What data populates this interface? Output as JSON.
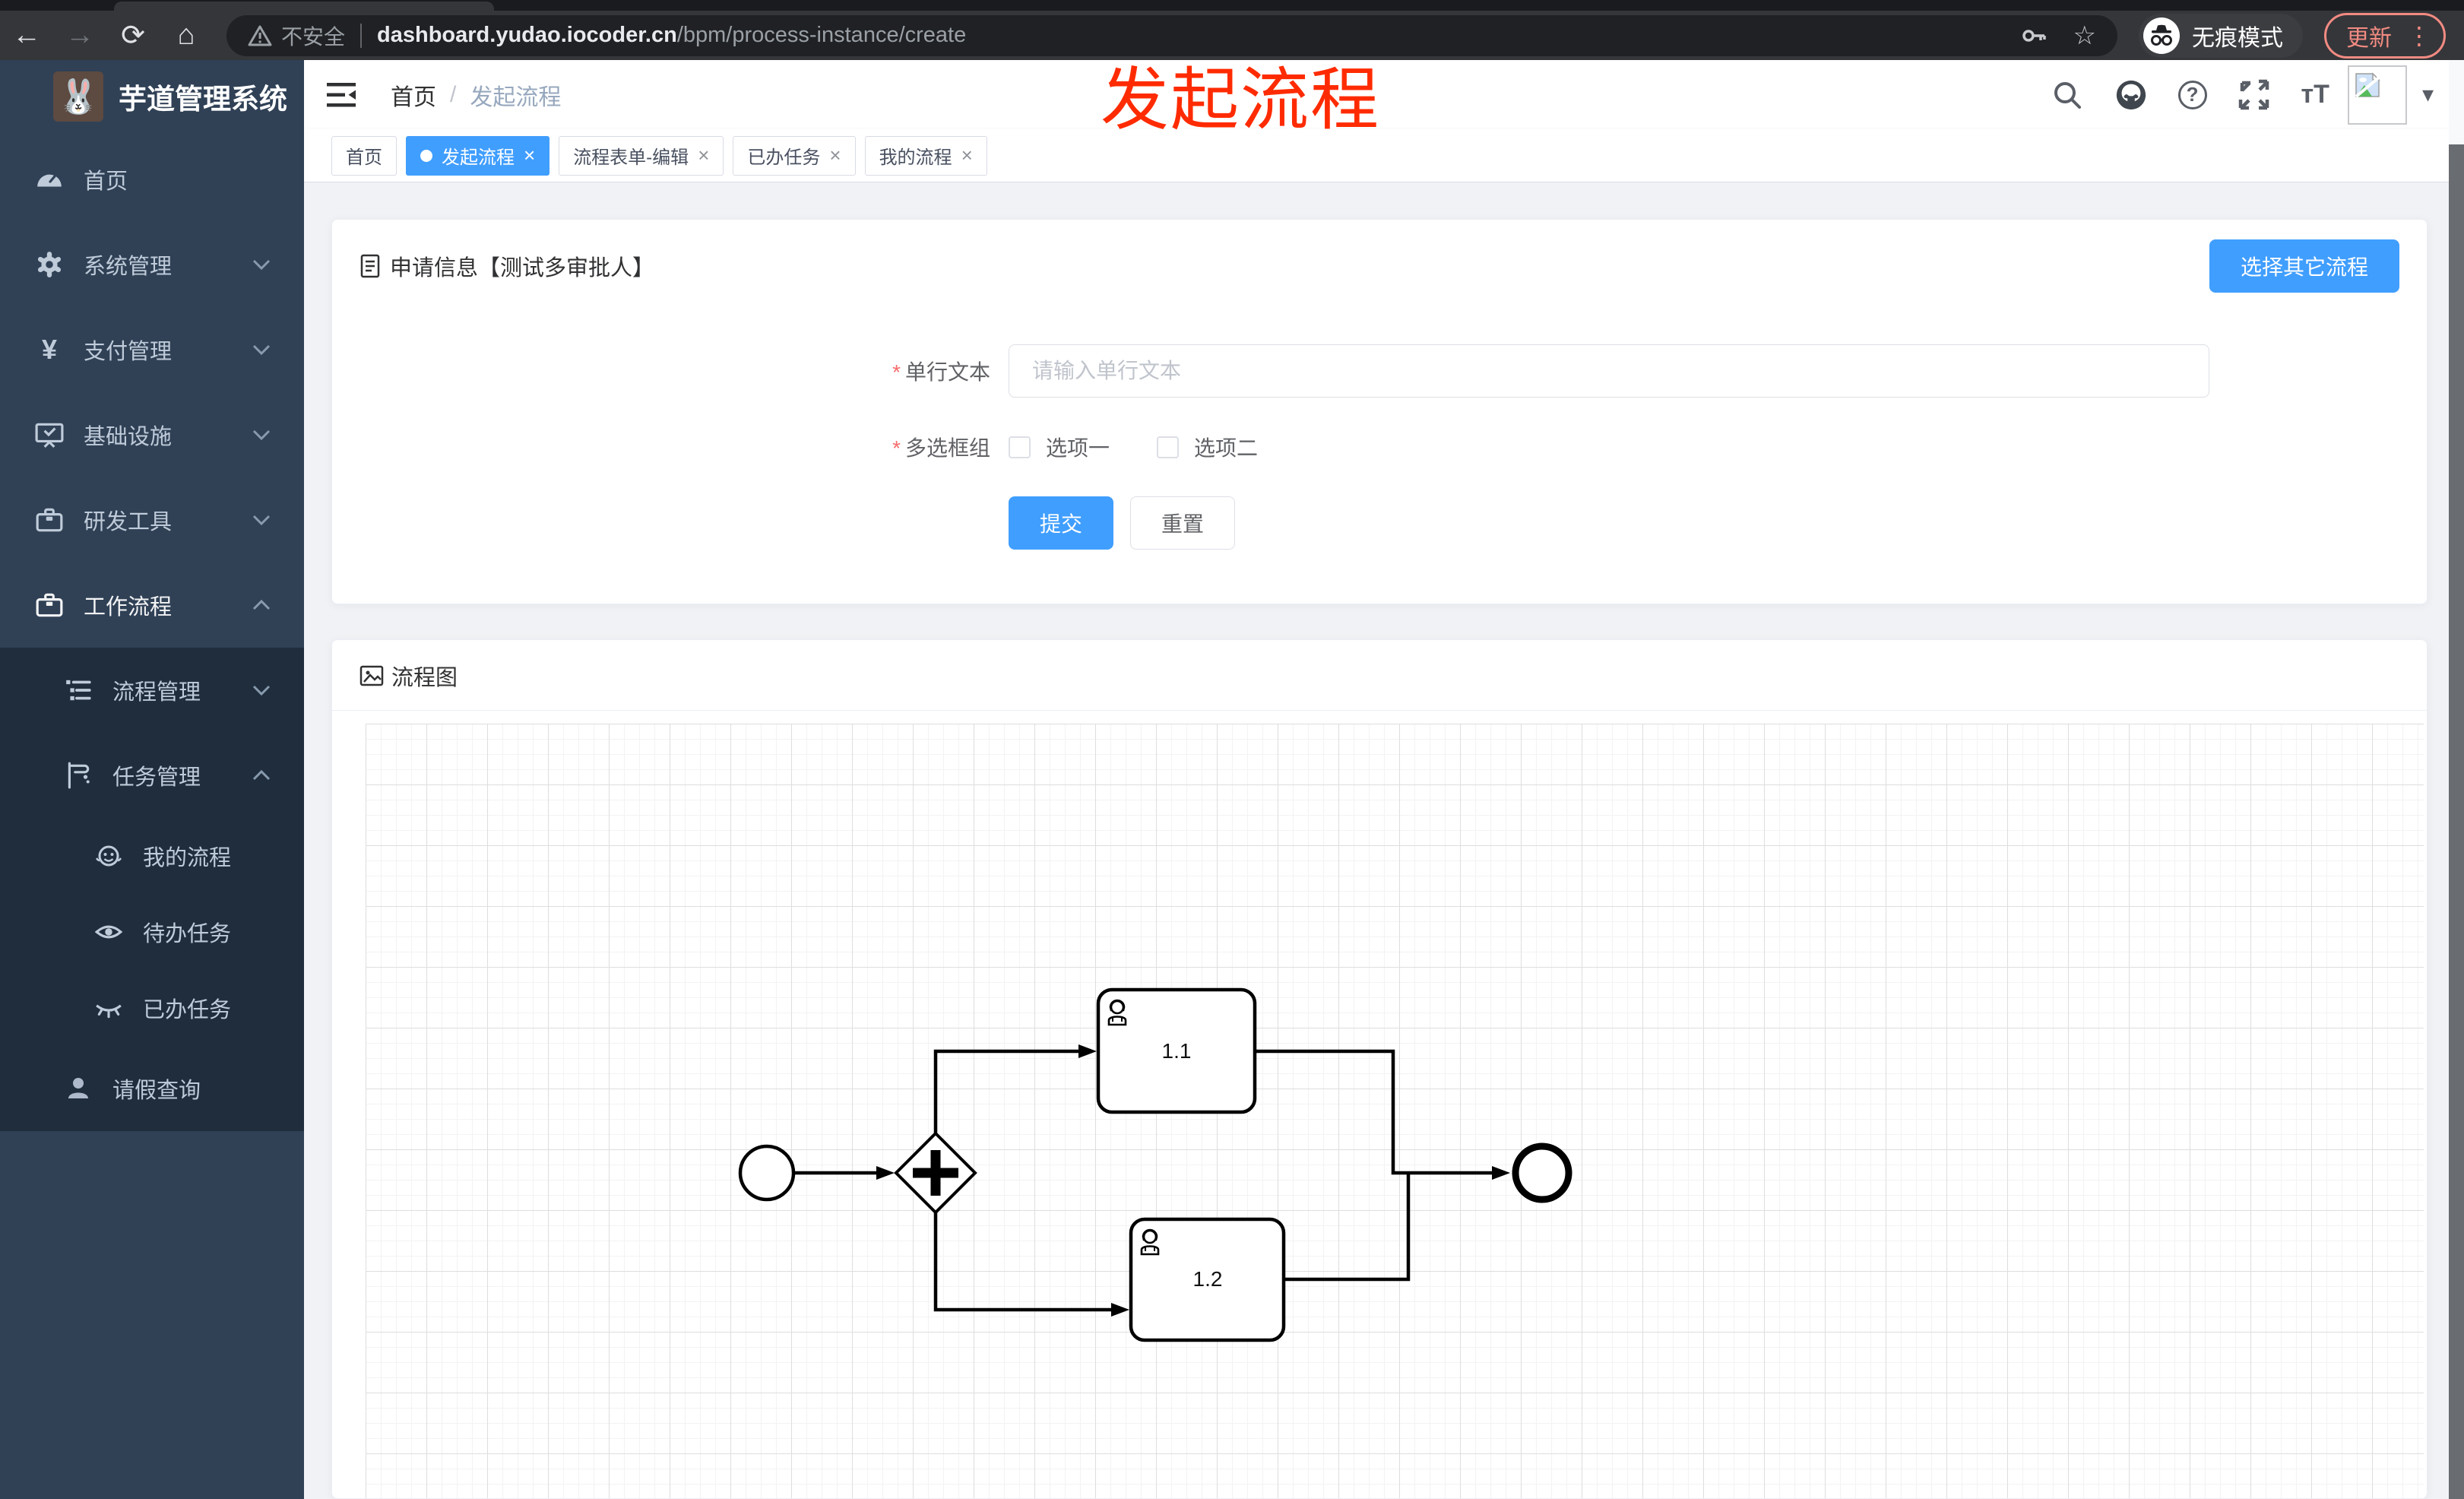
{
  "browser": {
    "security_label": "不安全",
    "url_host": "dashboard.yudao.iocoder.cn",
    "url_path": "/bpm/process-instance/create",
    "incognito_label": "无痕模式",
    "update_label": "更新"
  },
  "icons": {
    "back": "←",
    "forward": "→",
    "reload": "⟳",
    "home": "⌂",
    "star": "☆",
    "more_vertical": "⋮",
    "caret_down": "▾",
    "help": "?",
    "font_size": "тT",
    "yen": "¥",
    "breadcrumb_separator": "/",
    "close": "×",
    "logo_glyph": "🐰"
  },
  "sidebar": {
    "title": "芋道管理系统",
    "items": [
      {
        "label": "首页"
      },
      {
        "label": "系统管理"
      },
      {
        "label": "支付管理"
      },
      {
        "label": "基础设施"
      },
      {
        "label": "研发工具"
      },
      {
        "label": "工作流程"
      },
      {
        "label": "流程管理"
      },
      {
        "label": "任务管理"
      },
      {
        "label": "我的流程"
      },
      {
        "label": "待办任务"
      },
      {
        "label": "已办任务"
      },
      {
        "label": "请假查询"
      }
    ]
  },
  "header": {
    "breadcrumb_home": "首页",
    "breadcrumb_current": "发起流程",
    "annotation": "发起流程"
  },
  "tags": [
    {
      "label": "首页"
    },
    {
      "label": "发起流程"
    },
    {
      "label": "流程表单-编辑"
    },
    {
      "label": "已办任务"
    },
    {
      "label": "我的流程"
    }
  ],
  "form_card": {
    "title": "申请信息【测试多审批人】",
    "select_other_button": "选择其它流程",
    "required_mark": "*",
    "field_text": {
      "label": "单行文本",
      "placeholder": "请输入单行文本",
      "value": ""
    },
    "field_checkbox": {
      "label": "多选框组",
      "option1": "选项一",
      "option2": "选项二"
    },
    "submit_label": "提交",
    "reset_label": "重置"
  },
  "diagram_card": {
    "title": "流程图",
    "chart_data": {
      "type": "bpmn-flow",
      "nodes": [
        {
          "id": "start",
          "type": "startEvent",
          "label": ""
        },
        {
          "id": "gateway",
          "type": "parallelGateway",
          "label": ""
        },
        {
          "id": "task1",
          "type": "userTask",
          "label": "1.1"
        },
        {
          "id": "task2",
          "type": "userTask",
          "label": "1.2"
        },
        {
          "id": "end",
          "type": "endEvent",
          "label": ""
        }
      ],
      "edges": [
        [
          "start",
          "gateway"
        ],
        [
          "gateway",
          "task1"
        ],
        [
          "gateway",
          "task2"
        ],
        [
          "task1",
          "end"
        ],
        [
          "task2",
          "end"
        ]
      ]
    }
  },
  "colors": {
    "primary": "#409eff",
    "sidebar_bg": "#304156",
    "submenu_bg": "#1f2d3d",
    "page_bg": "#f0f2f5",
    "annotation_red": "#ff2b00",
    "update_red": "#f28b82"
  }
}
